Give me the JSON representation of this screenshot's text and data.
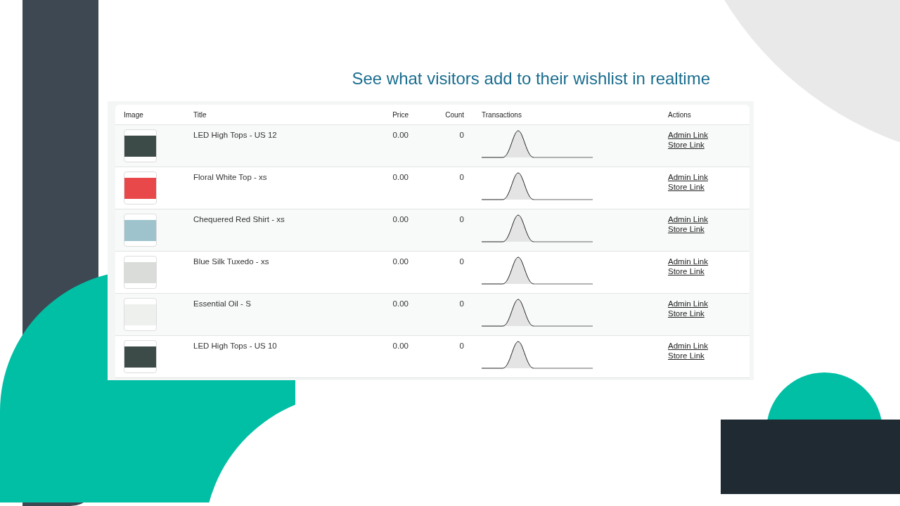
{
  "headline": "See what visitors add to their wishlist in realtime",
  "table": {
    "columns": [
      "Image",
      "Title",
      "Price",
      "Count",
      "Transactions",
      "Actions"
    ],
    "rows": [
      {
        "title": "LED High Tops - US 12",
        "price": "0.00",
        "count": "0",
        "links": [
          "Admin Link",
          "Store Link"
        ]
      },
      {
        "title": "Floral White Top - xs",
        "price": "0.00",
        "count": "0",
        "links": [
          "Admin Link",
          "Store Link"
        ]
      },
      {
        "title": "Chequered Red Shirt - xs",
        "price": "0.00",
        "count": "0",
        "links": [
          "Admin Link",
          "Store Link"
        ]
      },
      {
        "title": "Blue Silk Tuxedo - xs",
        "price": "0.00",
        "count": "0",
        "links": [
          "Admin Link",
          "Store Link"
        ]
      },
      {
        "title": "Essential Oil - S",
        "price": "0.00",
        "count": "0",
        "links": [
          "Admin Link",
          "Store Link"
        ]
      },
      {
        "title": "LED High Tops - US 10",
        "price": "0.00",
        "count": "0",
        "links": [
          "Admin Link",
          "Store Link"
        ]
      }
    ]
  }
}
